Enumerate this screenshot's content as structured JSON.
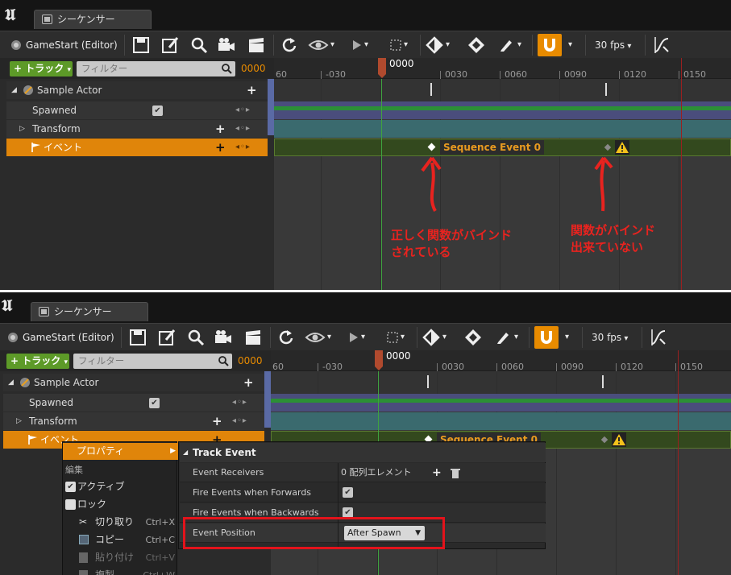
{
  "app_logo": "unreal-engine-logo",
  "panels": [
    {
      "tab_title": "シーケンサー",
      "toolbar": {
        "context_label": "GameStart (Editor)",
        "fps_label": "30 fps"
      },
      "filter": {
        "add_track": "トラック",
        "placeholder": "フィルター",
        "frame": "0000"
      },
      "tracks": [
        {
          "name": "Sample Actor"
        },
        {
          "name": "Spawned"
        },
        {
          "name": "Transform"
        },
        {
          "name": "イベント"
        }
      ],
      "ruler": {
        "current_frame": "0000",
        "ticks": [
          "60",
          "-030",
          "0030",
          "0060",
          "0090",
          "0120",
          "0150"
        ]
      },
      "event_section_label": "Sequence Event 0",
      "annotations": {
        "left": [
          "正しく関数がバインド",
          "されている"
        ],
        "right": [
          "関数がバインド",
          "出来ていない"
        ]
      }
    },
    {
      "tab_title": "シーケンサー",
      "toolbar": {
        "context_label": "GameStart (Editor)",
        "fps_label": "30 fps"
      },
      "filter": {
        "add_track": "トラック",
        "placeholder": "フィルター",
        "frame": "0000"
      },
      "tracks": [
        {
          "name": "Sample Actor"
        },
        {
          "name": "Spawned"
        },
        {
          "name": "Transform"
        },
        {
          "name": "イベント"
        }
      ],
      "ruler": {
        "current_frame": "0000",
        "ticks": [
          "60",
          "-030",
          "0030",
          "0060",
          "0090",
          "0120",
          "0150"
        ]
      },
      "event_section_label": "Sequence Event 0",
      "context_menu": {
        "properties": "プロパティ",
        "section_edit": "編集",
        "active": "アクティブ",
        "lock": "ロック",
        "cut": "切り取り",
        "cut_shortcut": "Ctrl+X",
        "copy": "コピー",
        "copy_shortcut": "Ctrl+C",
        "paste": "貼り付け",
        "paste_shortcut": "Ctrl+V",
        "duplicate": "複製",
        "duplicate_shortcut": "Ctrl+W"
      },
      "properties_panel": {
        "header": "Track Event",
        "rows": [
          {
            "name": "Event Receivers",
            "value": "0 配列エレメント"
          },
          {
            "name": "Fire Events when Forwards",
            "value": ""
          },
          {
            "name": "Fire Events when Backwards",
            "value": ""
          },
          {
            "name": "Event Position",
            "value": "After Spawn"
          }
        ]
      }
    }
  ],
  "colors": {
    "accent_orange": "#e88b00",
    "add_green": "#5d9a28",
    "annotation_red": "#e8231f",
    "highlight_red": "#e3131b"
  }
}
